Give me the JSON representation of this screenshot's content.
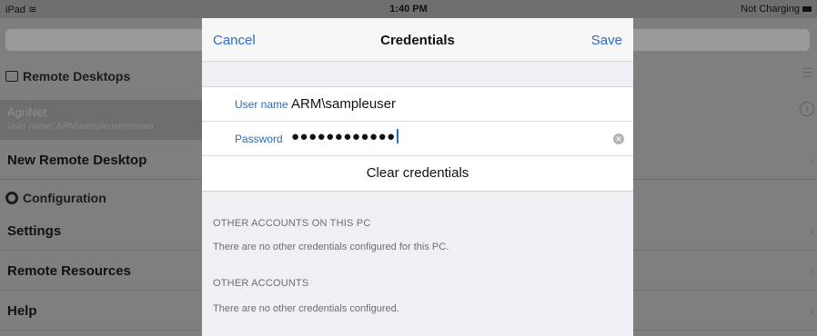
{
  "status_bar": {
    "device": "iPad",
    "wifi_icon": "wifi-icon",
    "time": "1:40 PM",
    "battery_text": "Not Charging"
  },
  "background": {
    "remote_desktops_header": "Remote Desktops",
    "agrinet_name": "AgriNet",
    "agrinet_detail": "User name: ARM\\sampleuser\\tenant",
    "new_remote_desktop": "New Remote Desktop",
    "configuration_header": "Configuration",
    "settings": "Settings",
    "remote_resources": "Remote Resources",
    "help": "Help",
    "chevron": "›",
    "info": "i",
    "menu": "☰"
  },
  "modal": {
    "cancel_label": "Cancel",
    "title": "Credentials",
    "save_label": "Save",
    "username_label": "User name",
    "username_value": "ARM\\sampleuser",
    "password_label": "Password",
    "password_value": "●●●●●●●●●●●●",
    "clear_field_glyph": "✕",
    "clear_credentials_label": "Clear credentials",
    "other_accounts_pc_header": "OTHER ACCOUNTS ON THIS PC",
    "other_accounts_pc_note": "There are no other credentials configured for this PC.",
    "other_accounts_header": "OTHER ACCOUNTS",
    "other_accounts_note": "There are no other credentials configured."
  },
  "colors": {
    "accent": "#2a6cc8",
    "dim_overlay": "#7f7f7f"
  }
}
